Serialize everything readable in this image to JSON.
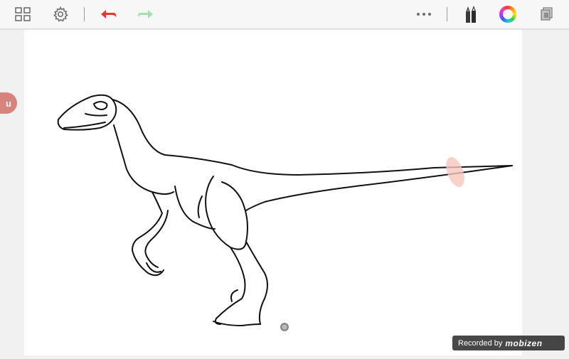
{
  "toolbar": {
    "left_icons": [
      "gallery-grid-icon",
      "settings-gear-icon",
      "undo-arrow-icon",
      "redo-arrow-icon"
    ],
    "right_icons": [
      "more-dots-icon",
      "brush-pens-icon",
      "color-wheel-icon",
      "layers-icon"
    ],
    "colors": {
      "undo": "#e23a2a",
      "redo": "#a9dfb0",
      "icon": "#6f6f6f"
    }
  },
  "side_badge": {
    "label": "u"
  },
  "recording_badge": {
    "prefix": "Recorded by",
    "brand": "mobizen"
  },
  "canvas": {
    "subject": "velociraptor line drawing",
    "background": "#ffffff"
  }
}
